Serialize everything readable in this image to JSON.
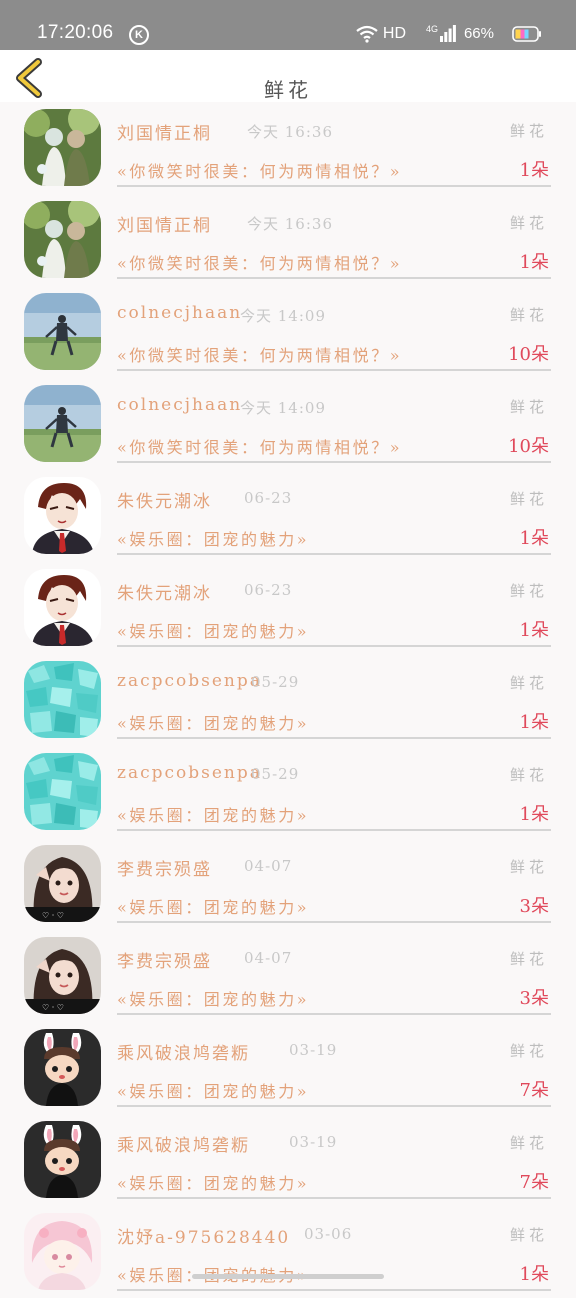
{
  "status_bar": {
    "time": "17:20:06",
    "app_badge": "K",
    "hd": "HD",
    "network": "4G",
    "battery": "66%"
  },
  "header": {
    "title": "鲜花",
    "back_icon": "chevron-left-icon"
  },
  "colors": {
    "accent": "#e3a27a",
    "count": "#e0495b",
    "muted": "#c8c8c8"
  },
  "items": [
    {
      "user": "刘国情正桐",
      "time": "今天 16:36",
      "type": "鲜花",
      "message": "«你微笑时很美：何为两情相悦？»",
      "count": "1朵",
      "avatar": "forest-girls"
    },
    {
      "user": "刘国情正桐",
      "time": "今天 16:36",
      "type": "鲜花",
      "message": "«你微笑时很美：何为两情相悦？»",
      "count": "1朵",
      "avatar": "forest-girls"
    },
    {
      "user": "colnecjhaan",
      "time": "今天 14:09",
      "type": "鲜花",
      "message": "«你微笑时很美：何为两情相悦？»",
      "count": "10朵",
      "avatar": "field-couple"
    },
    {
      "user": "colnecjhaan",
      "time": "今天 14:09",
      "type": "鲜花",
      "message": "«你微笑时很美：何为两情相悦？»",
      "count": "10朵",
      "avatar": "field-couple"
    },
    {
      "user": "朱佚元潮冰",
      "time": "06-23",
      "type": "鲜花",
      "message": "«娱乐圈：团宠的魅力»",
      "count": "1朵",
      "avatar": "anime-boy"
    },
    {
      "user": "朱佚元潮冰",
      "time": "06-23",
      "type": "鲜花",
      "message": "«娱乐圈：团宠的魅力»",
      "count": "1朵",
      "avatar": "anime-boy"
    },
    {
      "user": "zacpcobsenpa",
      "time": "05-29",
      "type": "鲜花",
      "message": "«娱乐圈：团宠的魅力»",
      "count": "1朵",
      "avatar": "teal-petals"
    },
    {
      "user": "zacpcobsenpa",
      "time": "05-29",
      "type": "鲜花",
      "message": "«娱乐圈：团宠的魅力»",
      "count": "1朵",
      "avatar": "teal-petals"
    },
    {
      "user": "李费宗殒盛",
      "time": "04-07",
      "type": "鲜花",
      "message": "«娱乐圈：团宠的魅力»",
      "count": "3朵",
      "avatar": "selfie-girl"
    },
    {
      "user": "李费宗殒盛",
      "time": "04-07",
      "type": "鲜花",
      "message": "«娱乐圈：团宠的魅力»",
      "count": "3朵",
      "avatar": "selfie-girl"
    },
    {
      "user": "乘风破浪鸠砻粝",
      "time": "03-19",
      "type": "鲜花",
      "message": "«娱乐圈：团宠的魅力»",
      "count": "7朵",
      "avatar": "bunny-kid"
    },
    {
      "user": "乘风破浪鸠砻粝",
      "time": "03-19",
      "type": "鲜花",
      "message": "«娱乐圈：团宠的魅力»",
      "count": "7朵",
      "avatar": "bunny-kid"
    },
    {
      "user": "沈妤a-975628440",
      "time": "03-06",
      "type": "鲜花",
      "message": "«娱乐圈：团宠的魅力»",
      "count": "1朵",
      "avatar": "pink-anime"
    }
  ]
}
